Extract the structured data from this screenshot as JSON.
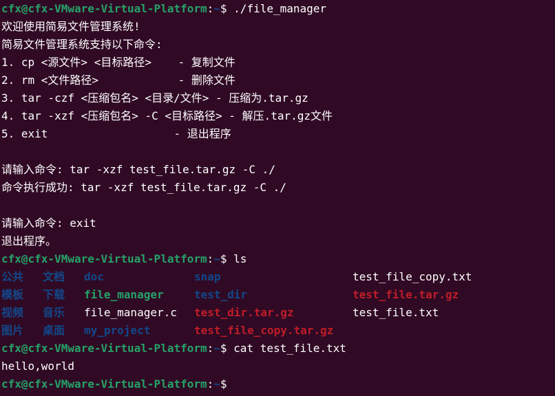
{
  "theme": {
    "background": "#300a24",
    "text": "#ffffff",
    "prompt_user": "#26a269",
    "prompt_path": "#12488b",
    "dir": "#2a7bde",
    "exec": "#26a269",
    "archive": "#c01c28"
  },
  "prompt": {
    "userhost": "cfx@cfx-VMware-Virtual-Platform",
    "sep": ":",
    "path": "~",
    "symbol": "$ "
  },
  "session": {
    "cmd1": "./file_manager",
    "welcome": "欢迎使用简易文件管理系统!",
    "supports": "简易文件管理系统支持以下命令:",
    "menu": [
      "1. cp <源文件> <目标路径>    - 复制文件",
      "2. rm <文件路径>            - 删除文件",
      "3. tar -czf <压缩包名> <目录/文件> - 压缩为.tar.gz",
      "4. tar -xzf <压缩包名> -C <目标路径> - 解压.tar.gz文件",
      "5. exit                   - 退出程序"
    ],
    "input1": "请输入命令: tar -xzf test_file.tar.gz -C ./",
    "success1": "命令执行成功: tar -xzf test_file.tar.gz -C ./",
    "input2": "请输入命令: exit",
    "exit_msg": "退出程序。",
    "cmd2": "ls",
    "ls_rows": [
      [
        {
          "name": "公共",
          "type": "dir-dim"
        },
        {
          "name": "文档",
          "type": "dir-dim"
        },
        {
          "name": "doc",
          "type": "dir-dim"
        },
        {
          "name": "snap",
          "type": "dir-dim"
        },
        {
          "name": "test_file_copy.txt",
          "type": "plain"
        }
      ],
      [
        {
          "name": "模板",
          "type": "dir-dim"
        },
        {
          "name": "下载",
          "type": "dir-dim"
        },
        {
          "name": "file_manager",
          "type": "exec"
        },
        {
          "name": "test_dir",
          "type": "dir-dim"
        },
        {
          "name": "test_file.tar.gz",
          "type": "archive"
        }
      ],
      [
        {
          "name": "视频",
          "type": "dir-dim"
        },
        {
          "name": "音乐",
          "type": "dir-dim"
        },
        {
          "name": "file_manager.c",
          "type": "plain"
        },
        {
          "name": "test_dir.tar.gz",
          "type": "archive"
        },
        {
          "name": "test_file.txt",
          "type": "plain"
        }
      ],
      [
        {
          "name": "图片",
          "type": "dir-dim"
        },
        {
          "name": "桌面",
          "type": "dir-dim"
        },
        {
          "name": "my_project",
          "type": "dir-dim"
        },
        {
          "name": "test_file_copy.tar.gz",
          "type": "archive"
        },
        {
          "name": "",
          "type": "plain"
        }
      ]
    ],
    "cmd3": "cat test_file.txt",
    "cat_output": "hello,world"
  }
}
